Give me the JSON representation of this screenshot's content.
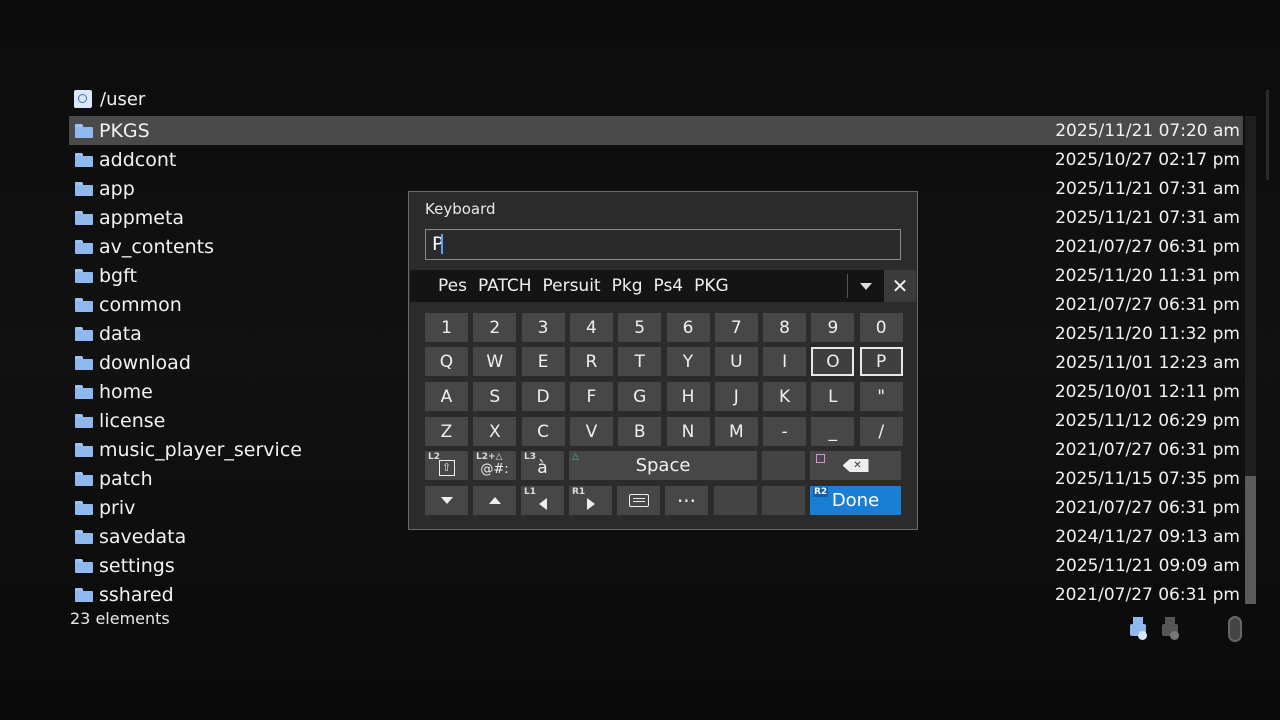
{
  "header": {
    "path": "/user"
  },
  "files": [
    {
      "name": "PKGS",
      "date": "2025/11/21 07:20 am"
    },
    {
      "name": "addcont",
      "date": "2025/10/27 02:17 pm"
    },
    {
      "name": "app",
      "date": "2025/11/21 07:31 am"
    },
    {
      "name": "appmeta",
      "date": "2025/11/21 07:31 am"
    },
    {
      "name": "av_contents",
      "date": "2021/07/27 06:31 pm"
    },
    {
      "name": "bgft",
      "date": "2025/11/20 11:31 pm"
    },
    {
      "name": "common",
      "date": "2021/07/27 06:31 pm"
    },
    {
      "name": "data",
      "date": "2025/11/20 11:32 pm"
    },
    {
      "name": "download",
      "date": "2025/11/01 12:23 am"
    },
    {
      "name": "home",
      "date": "2025/10/01 12:11 pm"
    },
    {
      "name": "license",
      "date": "2025/11/12 06:29 pm"
    },
    {
      "name": "music_player_service",
      "date": "2021/07/27 06:31 pm"
    },
    {
      "name": "patch",
      "date": "2025/11/15 07:35 pm"
    },
    {
      "name": "priv",
      "date": "2021/07/27 06:31 pm"
    },
    {
      "name": "savedata",
      "date": "2024/11/27 09:13 am"
    },
    {
      "name": "settings",
      "date": "2025/11/21 09:09 am"
    },
    {
      "name": "sshared",
      "date": "2021/07/27 06:31 pm"
    }
  ],
  "selected_index": 0,
  "footer": {
    "count": "23 elements"
  },
  "keyboard": {
    "title": "Keyboard",
    "input_value": "P",
    "suggestions": [
      "Pes",
      "PATCH",
      "Persuit",
      "Pkg",
      "Ps4",
      "PKG"
    ],
    "close_label": "✕",
    "rows": [
      [
        "1",
        "2",
        "3",
        "4",
        "5",
        "6",
        "7",
        "8",
        "9",
        "0"
      ],
      [
        "Q",
        "W",
        "E",
        "R",
        "T",
        "Y",
        "U",
        "I",
        "O",
        "P"
      ],
      [
        "A",
        "S",
        "D",
        "F",
        "G",
        "H",
        "J",
        "K",
        "L",
        "\""
      ],
      [
        "Z",
        "X",
        "C",
        "V",
        "B",
        "N",
        "M",
        "-",
        "_",
        "/"
      ]
    ],
    "focused_keys": [
      "O",
      "P"
    ],
    "fn_row": {
      "shift_tag": "L2",
      "shift_glyph": "⇧",
      "symbols_tag": "L2+△",
      "symbols_label": "@#:",
      "accent_tag": "L3",
      "accent_label": "à",
      "space_label": "Space"
    },
    "nav_row": {
      "left_tag": "L1",
      "right_tag": "R1",
      "more_label": "···",
      "done_tag": "R2",
      "done_label": "Done"
    },
    "backspace_glyph": "✕"
  },
  "colors": {
    "done_blue": "#1a7fd4",
    "folder_blue": "#8fb8ef",
    "selected_row": "#4a4a4a"
  }
}
